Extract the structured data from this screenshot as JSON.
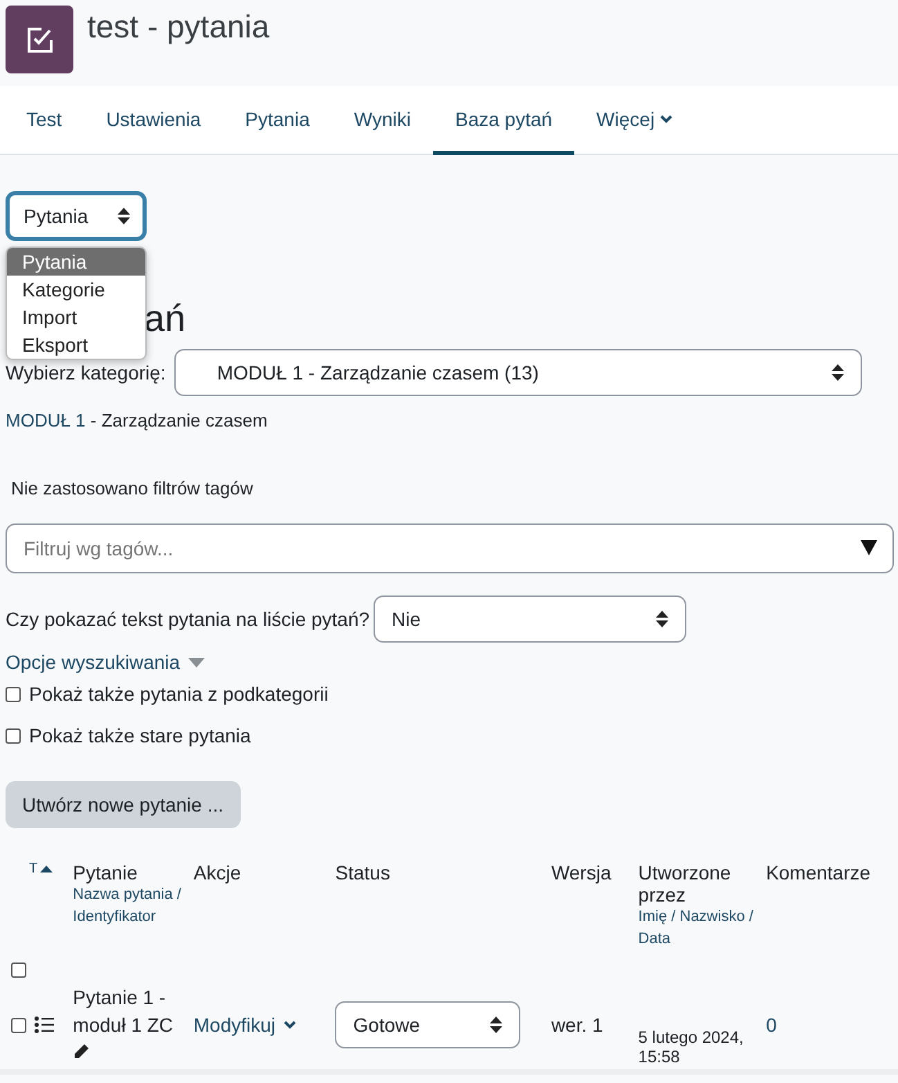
{
  "header": {
    "title": "test - pytania"
  },
  "tabs": [
    {
      "label": "Test",
      "selected": false
    },
    {
      "label": "Ustawienia",
      "selected": false
    },
    {
      "label": "Pytania",
      "selected": false
    },
    {
      "label": "Wyniki",
      "selected": false
    },
    {
      "label": "Baza pytań",
      "selected": true
    },
    {
      "label": "Więcej",
      "selected": false,
      "kind": "menu"
    }
  ],
  "nav_select": {
    "value": "Pytania",
    "options": [
      {
        "label": "Pytania",
        "selected": true
      },
      {
        "label": "Kategorie",
        "selected": false
      },
      {
        "label": "Import",
        "selected": false
      },
      {
        "label": "Eksport",
        "selected": false
      }
    ]
  },
  "heading": "ań",
  "category": {
    "label": "Wybierz kategorię:",
    "value": "MODUŁ 1 - Zarządzanie czasem (13)"
  },
  "breadcrumb": {
    "link": "MODUŁ 1",
    "rest": " - Zarządzanie czasem"
  },
  "tag_filter": {
    "note": "Nie zastosowano filtrów tagów",
    "placeholder": "Filtruj wg tagów..."
  },
  "show_text": {
    "label": "Czy pokazać tekst pytania na liście pytań?",
    "value": "Nie"
  },
  "search_options": {
    "label": "Opcje wyszukiwania",
    "checkboxes": [
      {
        "label": "Pokaż także pytania z podkategorii",
        "checked": false
      },
      {
        "label": "Pokaż także stare pytania",
        "checked": false
      }
    ]
  },
  "create_button": "Utwórz nowe pytanie ...",
  "table": {
    "sort_label": "T",
    "select_all_checked": false,
    "columns": [
      {
        "title": "Pytanie",
        "sub": "Nazwa pytania / Identyfikator"
      },
      {
        "title": "Akcje"
      },
      {
        "title": "Status"
      },
      {
        "title": "Wersja"
      },
      {
        "title": "Utworzone przez",
        "sub": "Imię / Nazwisko / Data"
      },
      {
        "title": "Komentarze"
      }
    ],
    "rows": [
      {
        "checked": false,
        "name": "Pytanie 1 - moduł 1 ZC",
        "action": "Modyfikuj",
        "status": "Gotowe",
        "version": "wer. 1",
        "created": "5 lutego 2024, 15:58",
        "comments": "0"
      }
    ]
  }
}
